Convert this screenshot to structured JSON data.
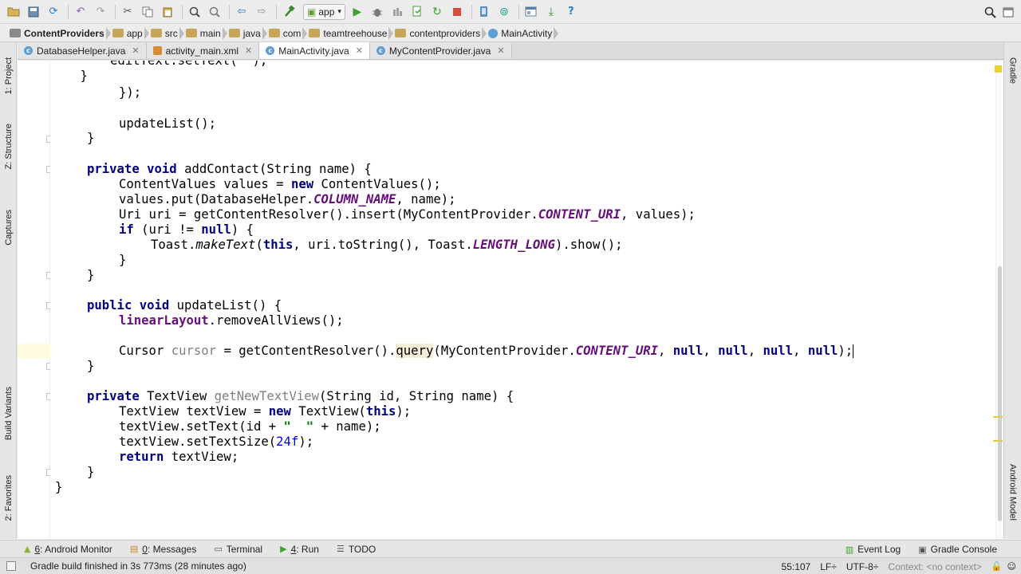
{
  "toolbar": {
    "run_config": "app",
    "help": "?"
  },
  "breadcrumb": [
    "ContentProviders",
    "app",
    "src",
    "main",
    "java",
    "com",
    "teamtreehouse",
    "contentproviders",
    "MainActivity"
  ],
  "tabs": [
    {
      "label": "DatabaseHelper.java",
      "type": "class"
    },
    {
      "label": "activity_main.xml",
      "type": "xml"
    },
    {
      "label": "MainActivity.java",
      "type": "class"
    },
    {
      "label": "MyContentProvider.java",
      "type": "class"
    }
  ],
  "left_tools": {
    "project": "1: Project",
    "structure": "Z: Structure",
    "captures": "Captures",
    "build_variants": "Build Variants",
    "favorites": "2: Favorites"
  },
  "right_tools": {
    "gradle": "Gradle",
    "android_model": "Android Model"
  },
  "code": {
    "l1": "        editText.setText(\"\");",
    "l2": "    }",
    "l3a": "});",
    "l4": "updateList();",
    "l5": "}",
    "l6_kw": "private void ",
    "l6": "addContact(String name) {",
    "l7a": "ContentValues values = ",
    "l7kw": "new ",
    "l7b": "ContentValues();",
    "l8a": "values.put(DatabaseHelper.",
    "l8f": "COLUMN_NAME",
    "l8b": ", name);",
    "l9a": "Uri uri = getContentResolver().insert(MyContentProvider.",
    "l9f": "CONTENT_URI",
    "l9b": ", values);",
    "l10kw": "if ",
    "l10a": "(uri != ",
    "l10kw2": "null",
    "l10b": ") {",
    "l11a": "Toast.",
    "l11st": "makeText",
    "l11b": "(",
    "l11kw": "this",
    "l11c": ", uri.toString(), Toast.",
    "l11f": "LENGTH_LONG",
    "l11d": ").show();",
    "l12": "}",
    "l13": "}",
    "l14kw": "public void ",
    "l14": "updateList() {",
    "l15f": "linearLayout",
    "l15": ".removeAllViews();",
    "l16a": "Cursor ",
    "l16u": "cursor",
    "l16b": " = getContentResolver().",
    "l16q": "query",
    "l16c": "(MyContentProvider.",
    "l16f": "CONTENT_URI",
    "l16d": ", ",
    "l16n": "null",
    "l16e": ");",
    "l17": "}",
    "l18kw": "private ",
    "l18a": "TextView ",
    "l18u": "getNewTextView",
    "l18b": "(String id, String name) {",
    "l19a": "TextView textView = ",
    "l19kw": "new ",
    "l19b": "TextView(",
    "l19kw2": "this",
    "l19c": ");",
    "l20a": "textView.setText(id + ",
    "l20s": "\"  \"",
    "l20b": " + name);",
    "l21a": "textView.setTextSize(",
    "l21n": "24f",
    "l21b": ");",
    "l22kw": "return ",
    "l22": "textView;",
    "l23": "}",
    "l24": "}"
  },
  "bottom_tools": {
    "android_monitor_key": "6",
    "android_monitor": ": Android Monitor",
    "messages_key": "0",
    "messages": ": Messages",
    "terminal": "Terminal",
    "run_key": "4",
    "run": ": Run",
    "todo": "TODO",
    "event_log": "Event Log",
    "gradle_console": "Gradle Console"
  },
  "status": {
    "message": "Gradle build finished in 3s 773ms (28 minutes ago)",
    "position": "55:107",
    "line_sep": "LF÷",
    "encoding": "UTF-8÷",
    "context": "Context: <no context>"
  },
  "colors": {
    "keyword": "#000080",
    "field": "#660e7a",
    "number": "#0000ff",
    "string": "#008000",
    "unused": "#808080",
    "current_line": "#fffbe0"
  }
}
